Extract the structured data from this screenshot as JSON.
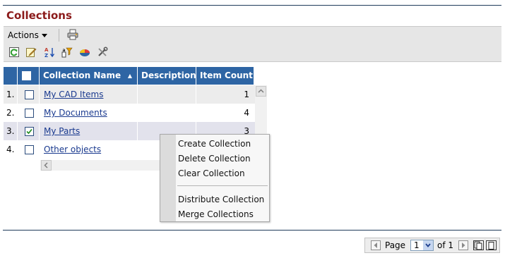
{
  "page": {
    "title": "Collections"
  },
  "toolbar": {
    "actions_label": "Actions",
    "icons": [
      "print-icon",
      "refresh-icon",
      "edit-icon",
      "sort-az-icon",
      "filter-icon",
      "chart-icon",
      "tools-icon"
    ]
  },
  "table": {
    "columns": [
      "Collection Name",
      "Description",
      "Item Count"
    ],
    "sort_indicator": "▲",
    "rows": [
      {
        "num": "1.",
        "checked": false,
        "name": "My CAD Items",
        "description": "",
        "count": "1"
      },
      {
        "num": "2.",
        "checked": false,
        "name": "My Documents",
        "description": "",
        "count": "4"
      },
      {
        "num": "3.",
        "checked": true,
        "name": "My Parts",
        "description": "",
        "count": "3"
      },
      {
        "num": "4.",
        "checked": false,
        "name": "Other objects",
        "description": "",
        "count": ""
      }
    ]
  },
  "context_menu": {
    "items": [
      "Create Collection",
      "Delete Collection",
      "Clear Collection",
      "Distribute Collection",
      "Merge Collections"
    ]
  },
  "pager": {
    "page_label": "Page",
    "current_page": "1",
    "of_label": "of 1"
  },
  "colors": {
    "header_bg": "#2e65a4",
    "title": "#8b1a1a",
    "selected_row": "#e2e2ec",
    "link": "#1a3a8f"
  }
}
